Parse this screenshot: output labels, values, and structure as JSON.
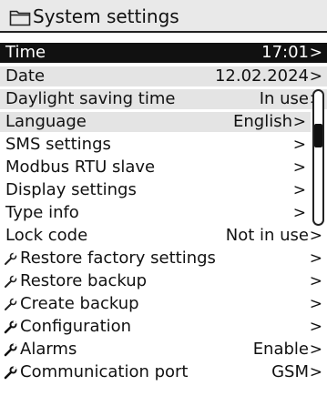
{
  "header": {
    "title": "System settings",
    "icon": "folder-icon"
  },
  "menu": {
    "arrow": ">",
    "items": [
      {
        "label": "Time",
        "value": "17:01",
        "icon": ""
      },
      {
        "label": "Date",
        "value": "12.02.2024",
        "icon": ""
      },
      {
        "label": "Daylight saving time",
        "value": "In use",
        "icon": ""
      },
      {
        "label": "Language",
        "value": "English",
        "icon": ""
      },
      {
        "label": "SMS settings",
        "value": "",
        "icon": ""
      },
      {
        "label": "Modbus RTU slave",
        "value": "",
        "icon": ""
      },
      {
        "label": "Display settings",
        "value": "",
        "icon": ""
      },
      {
        "label": "Type info",
        "value": "",
        "icon": ""
      },
      {
        "label": "Lock code",
        "value": "Not in use",
        "icon": ""
      },
      {
        "label": "Restore factory settings",
        "value": "",
        "icon": "wrench-icon"
      },
      {
        "label": "Restore backup",
        "value": "",
        "icon": "wrench-icon"
      },
      {
        "label": "Create backup",
        "value": "",
        "icon": "wrench-icon"
      },
      {
        "label": "Configuration",
        "value": "",
        "icon": "wrench-icon"
      },
      {
        "label": "Alarms",
        "value": "Enable",
        "icon": "wrench-icon"
      },
      {
        "label": "Communication port",
        "value": "GSM",
        "icon": "wrench-icon"
      }
    ]
  },
  "scrollbar": {
    "position": 0.3
  }
}
